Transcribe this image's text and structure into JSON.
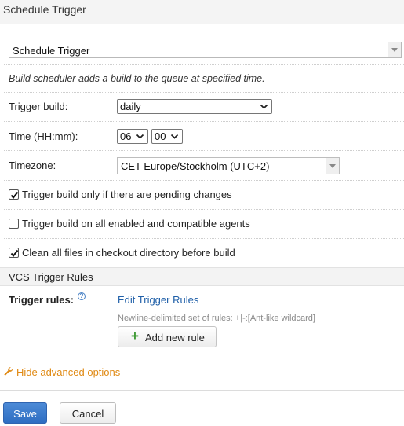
{
  "dialog": {
    "title": "Schedule Trigger"
  },
  "trigger_type": {
    "value": "Schedule Trigger"
  },
  "description": "Build scheduler adds a build to the queue at specified time.",
  "trigger_build": {
    "label": "Trigger build:",
    "value": "daily"
  },
  "time": {
    "label": "Time (HH:mm):",
    "hour": "06",
    "minute": "00"
  },
  "timezone": {
    "label": "Timezone:",
    "value": "CET Europe/Stockholm (UTC+2)"
  },
  "options": [
    {
      "label": "Trigger build only if there are pending changes",
      "checked": true
    },
    {
      "label": "Trigger build on all enabled and compatible agents",
      "checked": false
    },
    {
      "label": "Clean all files in checkout directory before build",
      "checked": true
    }
  ],
  "vcs": {
    "section_title": "VCS Trigger Rules",
    "rules_label": "Trigger rules:",
    "edit_link": "Edit Trigger Rules",
    "hint": "Newline-delimited set of rules: +|-:[Ant-like wildcard]",
    "add_button": "Add new rule"
  },
  "advanced_link": "Hide advanced options",
  "buttons": {
    "save": "Save",
    "cancel": "Cancel"
  },
  "colors": {
    "link": "#1f5fa8",
    "advanced": "#e08a14",
    "primary": "#2f6ec2",
    "add": "#3f9b35"
  },
  "icons": [
    "help-icon",
    "wrench-icon",
    "plus-icon",
    "checkmark-icon",
    "chevron-down-icon"
  ]
}
